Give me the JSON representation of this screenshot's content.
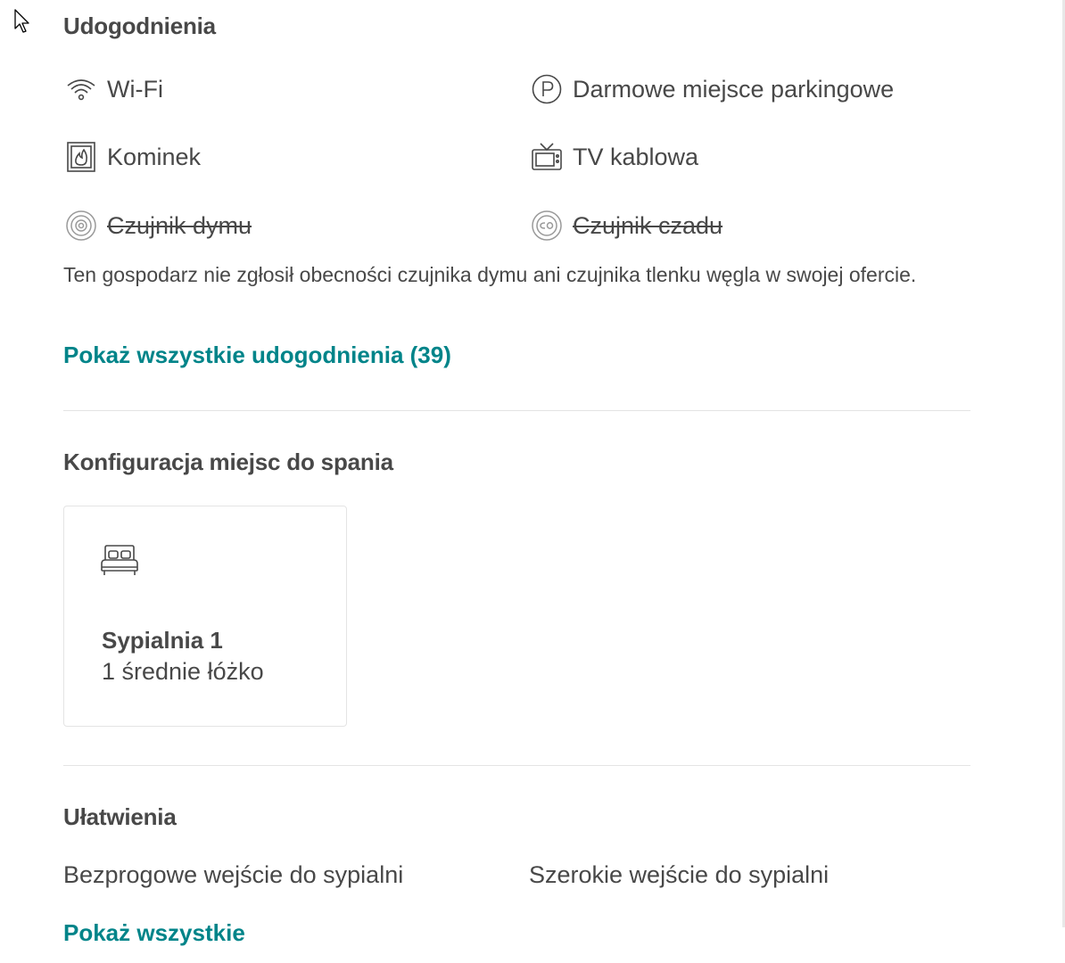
{
  "amenities": {
    "title": "Udogodnienia",
    "items": [
      {
        "label": "Wi-Fi",
        "icon": "wifi-icon",
        "available": true
      },
      {
        "label": "Darmowe miejsce parkingowe",
        "icon": "parking-icon",
        "available": true
      },
      {
        "label": "Kominek",
        "icon": "fireplace-icon",
        "available": true
      },
      {
        "label": "TV kablowa",
        "icon": "tv-icon",
        "available": true
      },
      {
        "label": "Czujnik dymu",
        "icon": "smoke-detector-icon",
        "available": false
      },
      {
        "label": "Czujnik czadu",
        "icon": "co-detector-icon",
        "available": false
      }
    ],
    "note": "Ten gospodarz nie zgłosił obecności czujnika dymu ani czujnika tlenku węgla w swojej ofercie.",
    "show_all": "Pokaż wszystkie udogodnienia (39)"
  },
  "sleeping": {
    "title": "Konfiguracja miejsc do spania",
    "rooms": [
      {
        "name": "Sypialnia 1",
        "beds": "1 średnie łóżko",
        "icon": "bed-icon"
      }
    ]
  },
  "accessibility": {
    "title": "Ułatwienia",
    "items": [
      "Bezprogowe wejście do sypialni",
      "Szerokie wejście do sypialni"
    ],
    "show_all": "Pokaż wszystkie"
  },
  "colors": {
    "text": "#484848",
    "link": "#008489",
    "divider": "#e4e4e4"
  }
}
